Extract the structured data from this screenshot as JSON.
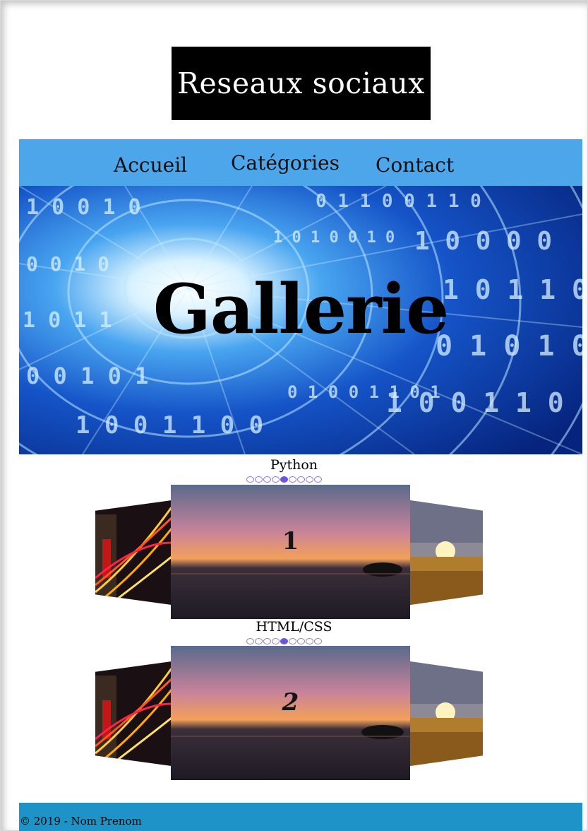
{
  "header": {
    "title": "Reseaux sociaux"
  },
  "nav": {
    "items": [
      {
        "label": "Accueil"
      },
      {
        "label": "Catégories"
      },
      {
        "label": "Contact"
      }
    ]
  },
  "hero": {
    "title": "Gallerie",
    "icon": "binary-tunnel-image"
  },
  "sliders": [
    {
      "label": "Python",
      "slide_number": "1",
      "dots_total": 8,
      "active_dot": 4
    },
    {
      "label": "HTML/CSS",
      "slide_number": "2",
      "dots_total": 8,
      "active_dot": 4
    }
  ],
  "footer": {
    "text": "© 2019 - Nom Prenom"
  },
  "colors": {
    "nav": "#4ea6ea",
    "footer": "#1e93c8",
    "dot_active": "#6b55e0",
    "title_bg": "#000000"
  }
}
